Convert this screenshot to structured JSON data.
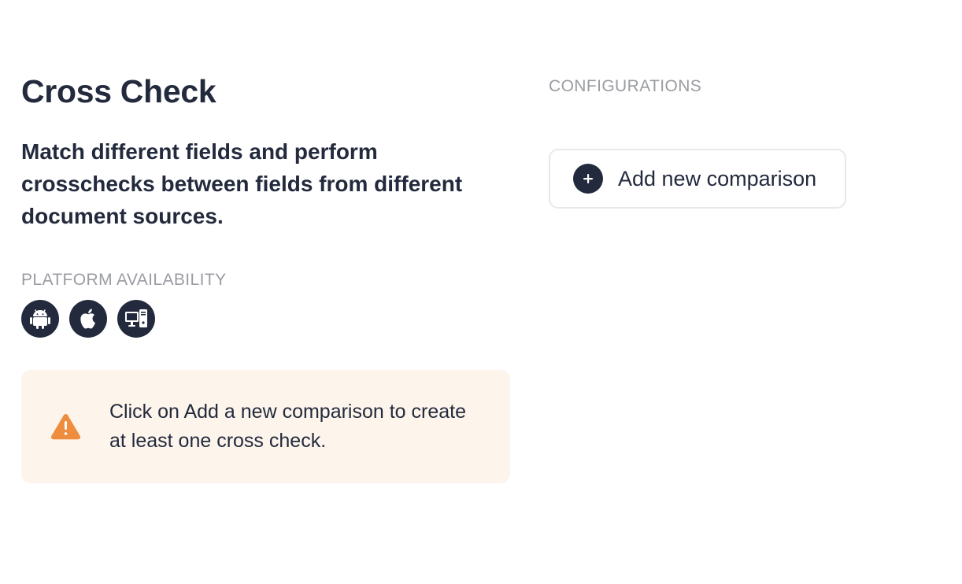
{
  "header": {
    "title": "Cross Check",
    "description": "Match different fields and perform crosschecks between fields from different document sources."
  },
  "platform": {
    "label": "PLATFORM AVAILABILITY",
    "icons": [
      "android-icon",
      "apple-icon",
      "desktop-web-icon"
    ]
  },
  "warning": {
    "icon": "warning-icon",
    "text": "Click on Add a new comparison to create at least one cross check.",
    "background_color": "#fdf5ec",
    "icon_color": "#ef8d3e"
  },
  "configurations": {
    "label": "CONFIGURATIONS",
    "add_button_label": "Add new comparison",
    "add_button_icon": "plus-circle-icon"
  },
  "colors": {
    "text_primary": "#232a3d",
    "text_muted": "#9a9ca3",
    "border": "#e7e8ec"
  }
}
